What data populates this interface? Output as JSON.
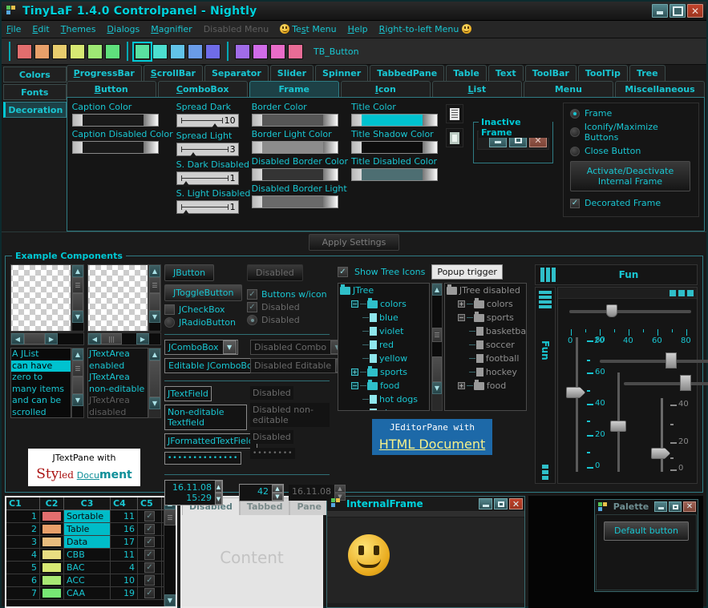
{
  "window": {
    "title": "TinyLaF 1.4.0 Controlpanel - Nightly",
    "icon": "app-squares-icon",
    "buttons": {
      "minimize": "minimize-icon",
      "maximize": "maximize-icon",
      "close": "close-icon"
    }
  },
  "menubar": {
    "items": [
      {
        "label": "File",
        "mnemonic": "F",
        "disabled": false
      },
      {
        "label": "Edit",
        "mnemonic": "E",
        "disabled": false
      },
      {
        "label": "Themes",
        "mnemonic": "T",
        "disabled": false
      },
      {
        "label": "Dialogs",
        "mnemonic": "D",
        "disabled": false
      },
      {
        "label": "Magnifier",
        "mnemonic": "M",
        "disabled": false
      },
      {
        "label": "Disabled Menu",
        "mnemonic": "",
        "disabled": true
      },
      {
        "label": "Test Menu",
        "mnemonic": "s",
        "disabled": false,
        "icon": "smiley-icon"
      },
      {
        "label": "Help",
        "mnemonic": "H",
        "disabled": false
      },
      {
        "label": "Right-to-left Menu",
        "mnemonic": "R",
        "disabled": false,
        "icon_after": "smiley-icon"
      }
    ]
  },
  "toolbar": {
    "label": "TB_Button",
    "swatches": [
      {
        "color": "#e36e6e",
        "selected": false
      },
      {
        "color": "#e8a06a",
        "selected": false
      },
      {
        "color": "#e8cd6e",
        "selected": false
      },
      {
        "color": "#d7e873",
        "selected": false
      },
      {
        "color": "#9de874",
        "selected": false
      },
      {
        "color": "#5fe07c",
        "selected": false
      },
      {
        "color": "#5ae0a0",
        "selected": true
      },
      {
        "color": "#4ddfd0",
        "selected": false
      },
      {
        "color": "#62c3e8",
        "selected": false
      },
      {
        "color": "#6a9ce8",
        "selected": false
      },
      {
        "color": "#6f6ce8",
        "selected": false
      },
      {
        "color": "#a06ce8",
        "selected": false
      },
      {
        "color": "#d06ce8",
        "selected": false
      },
      {
        "color": "#e86cc8",
        "selected": false
      },
      {
        "color": "#e86c96",
        "selected": false
      }
    ]
  },
  "vtabs": [
    {
      "label": "Colors",
      "active": false
    },
    {
      "label": "Fonts",
      "active": false
    },
    {
      "label": "Decoration",
      "active": true
    }
  ],
  "htabs_row1": [
    {
      "label": "ProgressBar",
      "mnemonic": "P",
      "active": false
    },
    {
      "label": "ScrollBar",
      "mnemonic": "S",
      "active": false
    },
    {
      "label": "Separator",
      "mnemonic": "",
      "active": false
    },
    {
      "label": "Slider",
      "mnemonic": "",
      "active": false
    },
    {
      "label": "Spinner",
      "mnemonic": "",
      "active": false
    },
    {
      "label": "TabbedPane",
      "mnemonic": "",
      "active": false
    },
    {
      "label": "Table",
      "mnemonic": "",
      "active": false
    },
    {
      "label": "Text",
      "mnemonic": "",
      "active": false
    },
    {
      "label": "ToolBar",
      "mnemonic": "",
      "active": false
    },
    {
      "label": "ToolTip",
      "mnemonic": "",
      "active": false
    },
    {
      "label": "Tree",
      "mnemonic": "",
      "active": false
    }
  ],
  "htabs_row2": [
    {
      "label": "Button",
      "mnemonic": "B",
      "active": false
    },
    {
      "label": "ComboBox",
      "mnemonic": "C",
      "active": false
    },
    {
      "label": "Frame",
      "mnemonic": "",
      "active": true
    },
    {
      "label": "Icon",
      "mnemonic": "I",
      "active": false
    },
    {
      "label": "List",
      "mnemonic": "L",
      "active": false
    },
    {
      "label": "Menu",
      "mnemonic": "",
      "active": false
    },
    {
      "label": "Miscellaneous",
      "mnemonic": "",
      "active": false
    }
  ],
  "frame_panel": {
    "col1": [
      {
        "label": "Caption Color",
        "type": "color",
        "value": "#1a1a1a"
      },
      {
        "label": "Caption Disabled Color",
        "type": "color",
        "value": "#1a1a1a"
      }
    ],
    "col2": [
      {
        "label": "Spread Dark",
        "type": "slider",
        "value": "10",
        "pos": 80
      },
      {
        "label": "Spread Light",
        "type": "slider",
        "value": "3",
        "pos": 22
      },
      {
        "label": "S. Dark Disabled",
        "type": "slider",
        "value": "1",
        "pos": 6
      },
      {
        "label": "S. Light Disabled",
        "type": "slider",
        "value": "1",
        "pos": 6
      }
    ],
    "col3": [
      {
        "label": "Border Color",
        "type": "color",
        "value": "#565656"
      },
      {
        "label": "Border Light Color",
        "type": "color",
        "value": "#8c8c8c"
      },
      {
        "label": "Disabled Border Color",
        "type": "color",
        "value": "#343434"
      },
      {
        "label": "Disabled Border Light",
        "type": "color",
        "value": "#6a6a6a"
      }
    ],
    "col4": [
      {
        "label": "Title Color",
        "type": "color",
        "value": "#00c2cf"
      },
      {
        "label": "Title Shadow Color",
        "type": "color",
        "value": "#0d0d0d"
      },
      {
        "label": "Title Disabled Color",
        "type": "color",
        "value": "#4d6e72"
      }
    ],
    "copy_icon": "copy-icon",
    "paste_icon": "paste-icon",
    "inactive_frame": {
      "legend": "Inactive Frame",
      "buttons": [
        "minimize-icon",
        "maximize-icon",
        "close-icon"
      ]
    },
    "radios": [
      {
        "label": "Frame",
        "selected": true
      },
      {
        "label": "Iconify/Maximize Buttons",
        "selected": false
      },
      {
        "label": "Close Button",
        "selected": false
      }
    ],
    "activate_button": {
      "line1": "Activate/Deactivate",
      "line2": "Internal Frame"
    },
    "decorated_frame": {
      "label": "Decorated Frame",
      "checked": true
    },
    "apply_button": "Apply Settings"
  },
  "examples": {
    "legend": "Example Components",
    "list": {
      "items": [
        {
          "text": "A JList",
          "selected": false
        },
        {
          "text": "can have",
          "selected": true
        },
        {
          "text": "zero to",
          "selected": false
        },
        {
          "text": "many items",
          "selected": false
        },
        {
          "text": "and can be",
          "selected": false
        },
        {
          "text": "scrolled",
          "selected": false
        }
      ]
    },
    "textarea": {
      "lines": [
        {
          "text": "JTextArea",
          "disabled": false
        },
        {
          "text": "enabled",
          "disabled": false
        },
        {
          "text": "JTextArea",
          "disabled": false
        },
        {
          "text": "non-editable",
          "disabled": false
        },
        {
          "text": "JTextArea",
          "disabled": true
        },
        {
          "text": "disabled",
          "disabled": true
        }
      ]
    },
    "textpane": {
      "line1": "JTextPane with",
      "styled": {
        "a": "Sty",
        "b": "led ",
        "c": "Docu",
        "d": "ment"
      }
    },
    "buttons": {
      "jbutton": "JButton",
      "jbutton_disabled": "Disabled",
      "jtogglebutton": "JToggleButton",
      "buttons_with_icon": "Buttons w/icon",
      "jcheckbox": "JCheckBox",
      "jcheckbox_disabled": "Disabled",
      "jradiobutton": "JRadioButton",
      "jradiobutton_disabled": "Disabled"
    },
    "combos": {
      "jcombobox": "JComboBox",
      "disabled_combo": "Disabled Combo",
      "editable_jcombobox": "Editable JComboBox",
      "disabled_editable": "Disabled Editable"
    },
    "fields": {
      "jtextfield": "JTextField",
      "jtextfield_disabled": "Disabled",
      "non_editable": "Non-editable Textfield",
      "non_editable_disabled": "Disabled non-editable",
      "jformatted": "JFormattedTextField",
      "jformatted_disabled": "Disabled",
      "password": "••••••••••••••",
      "password_disabled": "••••••••"
    },
    "spinners": {
      "datetime": "16.11.08 15:29",
      "number": "42",
      "date_disabled": "16.11.08"
    },
    "tree": {
      "show_icons_label": "Show Tree Icons",
      "show_icons_checked": true,
      "popup_trigger": "Popup trigger",
      "enabled_nodes": [
        {
          "label": "JTree",
          "depth": 0,
          "toggle": "none",
          "icon": "folder"
        },
        {
          "label": "colors",
          "depth": 1,
          "toggle": "minus",
          "icon": "folder"
        },
        {
          "label": "blue",
          "depth": 2,
          "toggle": "none",
          "icon": "file"
        },
        {
          "label": "violet",
          "depth": 2,
          "toggle": "none",
          "icon": "file"
        },
        {
          "label": "red",
          "depth": 2,
          "toggle": "none",
          "icon": "file"
        },
        {
          "label": "yellow",
          "depth": 2,
          "toggle": "none",
          "icon": "file"
        },
        {
          "label": "sports",
          "depth": 1,
          "toggle": "plus",
          "icon": "folder"
        },
        {
          "label": "food",
          "depth": 1,
          "toggle": "minus",
          "icon": "folder"
        },
        {
          "label": "hot dogs",
          "depth": 2,
          "toggle": "none",
          "icon": "file"
        },
        {
          "label": "pizza",
          "depth": 2,
          "toggle": "none",
          "icon": "file"
        }
      ],
      "disabled_nodes": [
        {
          "label": "JTree disabled",
          "depth": 0,
          "toggle": "none",
          "icon": "folder"
        },
        {
          "label": "colors",
          "depth": 1,
          "toggle": "plus",
          "icon": "folder"
        },
        {
          "label": "sports",
          "depth": 1,
          "toggle": "minus",
          "icon": "folder"
        },
        {
          "label": "basketball",
          "depth": 2,
          "toggle": "none",
          "icon": "file"
        },
        {
          "label": "soccer",
          "depth": 2,
          "toggle": "none",
          "icon": "file"
        },
        {
          "label": "football",
          "depth": 2,
          "toggle": "none",
          "icon": "file"
        },
        {
          "label": "hockey",
          "depth": 2,
          "toggle": "none",
          "icon": "file"
        },
        {
          "label": "food",
          "depth": 1,
          "toggle": "plus",
          "icon": "folder"
        }
      ]
    },
    "editorpane": {
      "line1": "JEditorPane with",
      "line2": "HTML Document"
    },
    "sliders": {
      "fun_title": "Fun",
      "fun_vertical": "Fun",
      "h_ticks": [
        "0",
        "20",
        "40",
        "60",
        "80"
      ],
      "v_ticks_enabled": [
        "80",
        "60",
        "40",
        "20",
        "0"
      ],
      "v_ticks_disabled": [
        "40",
        "20",
        "0"
      ]
    }
  },
  "table": {
    "columns": [
      "C1",
      "C2",
      "C3",
      "C4",
      "C5"
    ],
    "rows": [
      {
        "c1": "1",
        "c2": "#e36e6e",
        "c3": "Sortable",
        "c4": "11",
        "c5": true,
        "selected": true
      },
      {
        "c1": "2",
        "c2": "#e8a06a",
        "c3": "Table",
        "c4": "16",
        "c5": false,
        "selected": true
      },
      {
        "c1": "3",
        "c2": "#e8bd7e",
        "c3": "Data",
        "c4": "17",
        "c5": true,
        "selected": true
      },
      {
        "c1": "4",
        "c2": "#e8dd82",
        "c3": "CBB",
        "c4": "11",
        "c5": true,
        "selected": false
      },
      {
        "c1": "5",
        "c2": "#d7e873",
        "c3": "BAC",
        "c4": "4",
        "c5": false,
        "selected": false
      },
      {
        "c1": "6",
        "c2": "#a8e874",
        "c3": "ACC",
        "c4": "10",
        "c5": true,
        "selected": false
      },
      {
        "c1": "7",
        "c2": "#77e874",
        "c3": "CAA",
        "c4": "19",
        "c5": true,
        "selected": false
      }
    ]
  },
  "tabbedpane": {
    "tabs": [
      {
        "label": "Disabled",
        "active": true
      },
      {
        "label": "Tabbed",
        "active": false
      },
      {
        "label": "Pane",
        "active": false
      }
    ],
    "content": "Content"
  },
  "internalframe": {
    "title": "InternalFrame",
    "icon": "app-squares-icon",
    "buttons": [
      "minimize-icon",
      "maximize-icon",
      "close-icon"
    ],
    "content_icon": "big-smiley-icon"
  },
  "palette": {
    "title": "Palette",
    "buttons": [
      "minimize-icon",
      "maximize-icon",
      "close-icon"
    ],
    "default_button": "Default button"
  },
  "colors": {
    "accent": "#19c6d2",
    "accent_bright": "#00d2dc",
    "background": "#1a1a1a",
    "panel_border": "#2f7c84",
    "selection": "#00c2cf",
    "html_bg": "#1d69a8",
    "html_link": "#f5f08a"
  }
}
